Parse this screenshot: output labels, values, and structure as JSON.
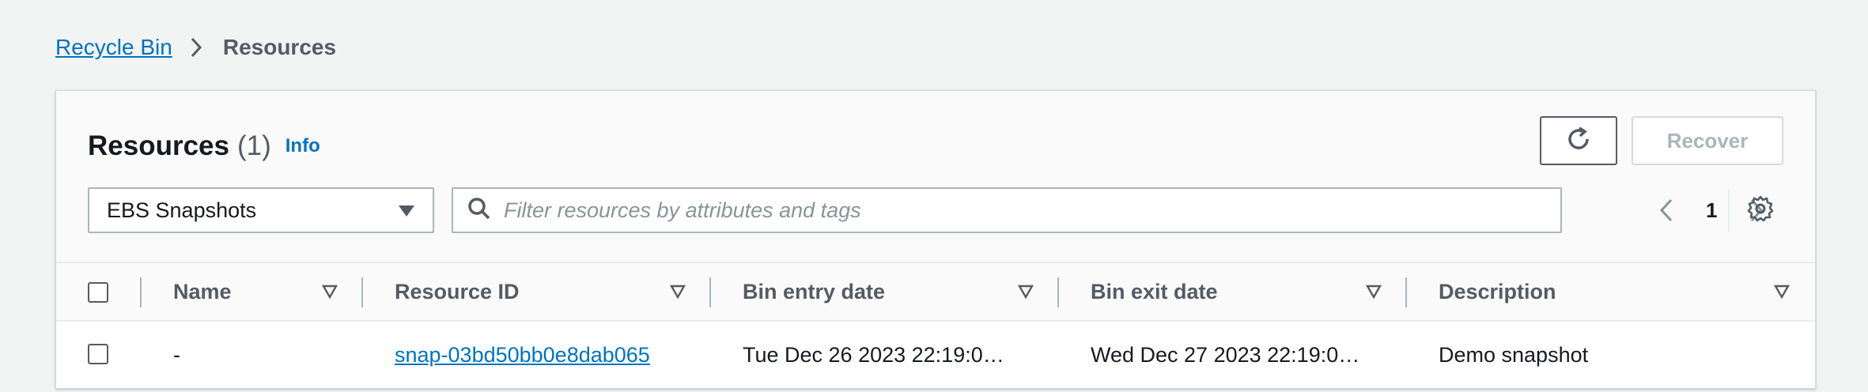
{
  "breadcrumb": {
    "items": [
      {
        "label": "Recycle Bin",
        "link": true
      },
      {
        "label": "Resources",
        "link": false
      }
    ]
  },
  "panel": {
    "title": "Resources",
    "count": "(1)",
    "info_label": "Info",
    "refresh_icon": "refresh-icon",
    "recover_label": "Recover"
  },
  "filter": {
    "resource_type_selected": "EBS Snapshots",
    "search_placeholder": "Filter resources by attributes and tags"
  },
  "pagination": {
    "current_page": "1"
  },
  "table": {
    "columns": [
      "Name",
      "Resource ID",
      "Bin entry date",
      "Bin exit date",
      "Description"
    ],
    "rows": [
      {
        "name": "-",
        "resource_id": "snap-03bd50bb0e8dab065",
        "bin_entry_date": "Tue Dec 26 2023 22:19:0…",
        "bin_exit_date": "Wed Dec 27 2023 22:19:0…",
        "description": "Demo snapshot"
      }
    ]
  },
  "colors": {
    "link": "#0073bb",
    "text": "#16191f",
    "muted": "#545b64",
    "disabled": "#aab7b8",
    "background": "#f2f3f3"
  }
}
